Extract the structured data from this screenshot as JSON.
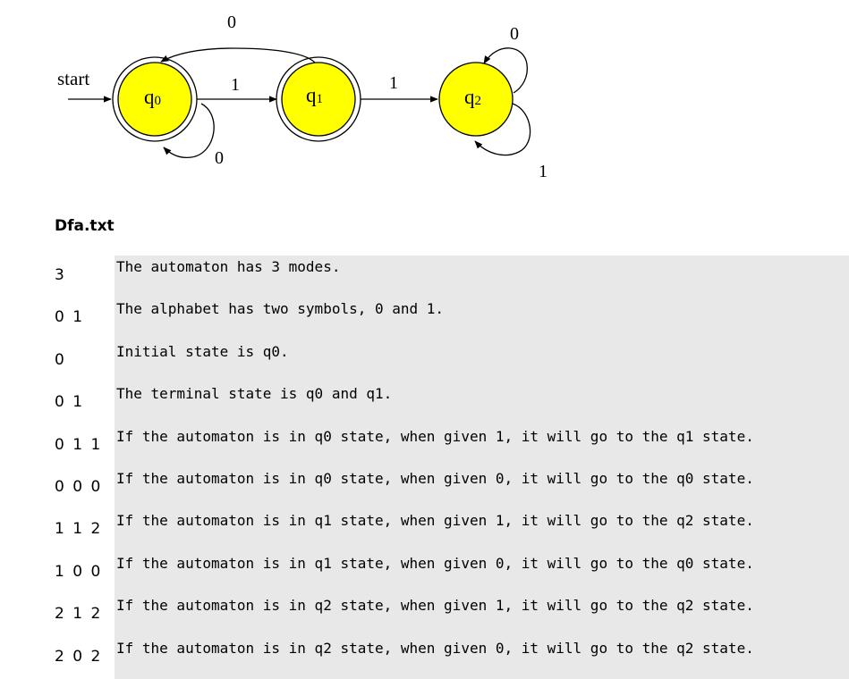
{
  "diagram": {
    "start_label": "start",
    "states": [
      {
        "id": "q0",
        "name": "q",
        "sub": "0",
        "accepting": true
      },
      {
        "id": "q1",
        "name": "q",
        "sub": "1",
        "accepting": true
      },
      {
        "id": "q2",
        "name": "q",
        "sub": "2",
        "accepting": false
      }
    ],
    "transitions": [
      {
        "from": "q0",
        "to": "q1",
        "symbol": "1"
      },
      {
        "from": "q1",
        "to": "q0",
        "symbol": "0"
      },
      {
        "from": "q0",
        "to": "q0",
        "symbol": "0"
      },
      {
        "from": "q1",
        "to": "q2",
        "symbol": "1"
      },
      {
        "from": "q2",
        "to": "q2",
        "symbol": "0"
      },
      {
        "from": "q2",
        "to": "q2",
        "symbol": "1"
      }
    ],
    "state_fill": "#ffff00",
    "stroke": "#000000"
  },
  "file": {
    "title": "Dfa.txt",
    "rows": [
      {
        "code": "3",
        "comment": "The automaton has 3 modes."
      },
      {
        "code": "0 1",
        "comment": "The alphabet has two symbols, 0 and 1."
      },
      {
        "code": "0",
        "comment": "Initial state is q0."
      },
      {
        "code": "0 1",
        "comment": "The terminal state is q0 and q1."
      },
      {
        "code": "0 1 1",
        "comment": "If the automaton is in q0 state, when given 1, it will go to the q1 state."
      },
      {
        "code": "0 0 0",
        "comment": "If the automaton is in q0 state, when given 0, it will go to the q0 state."
      },
      {
        "code": "1 1 2",
        "comment": "If the automaton is in q1 state, when given 1, it will go to the q2 state."
      },
      {
        "code": "1 0 0",
        "comment": "If the automaton is in q1 state, when given 0, it will go to the q0 state."
      },
      {
        "code": "2 1 2",
        "comment": "If the automaton is in q2 state, when given 1, it will go to the q2 state."
      },
      {
        "code": "2 0 2",
        "comment": "If the automaton is in q2 state, when given 0, it will go to the q2 state."
      }
    ],
    "comment_background": "#e8e8e8"
  }
}
